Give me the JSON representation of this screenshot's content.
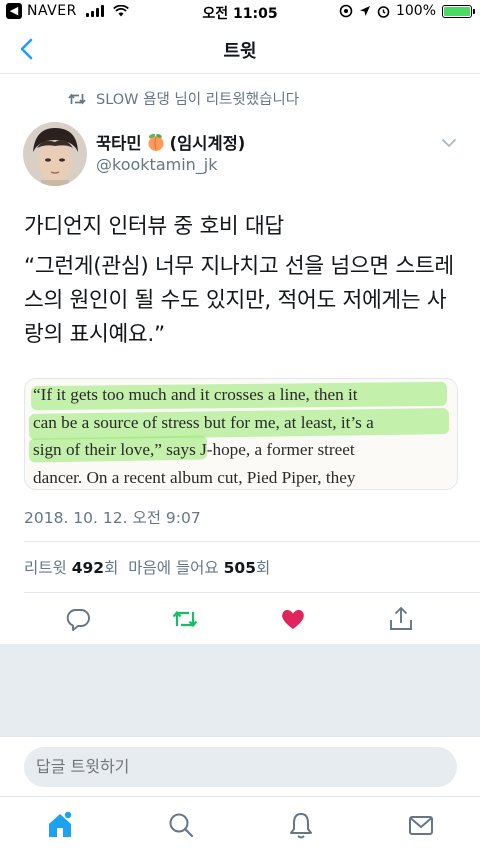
{
  "status_bar": {
    "back_app": "NAVER",
    "time": "오전 11:05",
    "battery": "100%",
    "battery_level": 1.0,
    "battery_color": "#4cd964"
  },
  "nav": {
    "title": "트윗",
    "back_icon": "chevron-left-icon"
  },
  "retweet_context": {
    "icon": "retweet-icon",
    "text": "SLOW 욤댕 님이 리트윗했습니다"
  },
  "author": {
    "name": "꾹타민",
    "name_suffix": "(임시계정)",
    "emoji_icon": "peach-emoji-icon",
    "handle": "@kooktamin_jk"
  },
  "tweet": {
    "line1": "가디언지 인터뷰 중 호비 대답",
    "line2": "“그런게(관심) 너무 지나치고 선을 넘으면 스트레스의 원인이 될 수도 있지만, 적어도 저에게는 사랑의 표시예요.”"
  },
  "media": {
    "lines": [
      "“If it gets too much and it crosses a line, then it",
      "can be a source of stress but for me, at least, it’s a",
      "sign of their love,” says J-hope, a former street",
      "dancer. On a recent album cut, Pied Piper, they"
    ],
    "highlight_color": "#96e86e"
  },
  "timestamp": "2018. 10. 12. 오전 9:07",
  "stats": {
    "retweets_label": "리트윗",
    "retweets_count": "492",
    "count_unit": "회",
    "likes_label": "마음에 들어요",
    "likes_count": "505",
    "likes_unit": "회"
  },
  "actions": {
    "reply": "reply-icon",
    "retweet": "retweet-icon",
    "like": "heart-icon",
    "share": "share-icon",
    "retweet_color": "#17bf63",
    "like_color": "#e0245e"
  },
  "reply_bar": {
    "placeholder": "답글 트윗하기"
  },
  "tabs": {
    "home": "home-icon",
    "search": "search-icon",
    "notifications": "bell-icon",
    "messages": "mail-icon",
    "accent": "#1da1f2"
  }
}
